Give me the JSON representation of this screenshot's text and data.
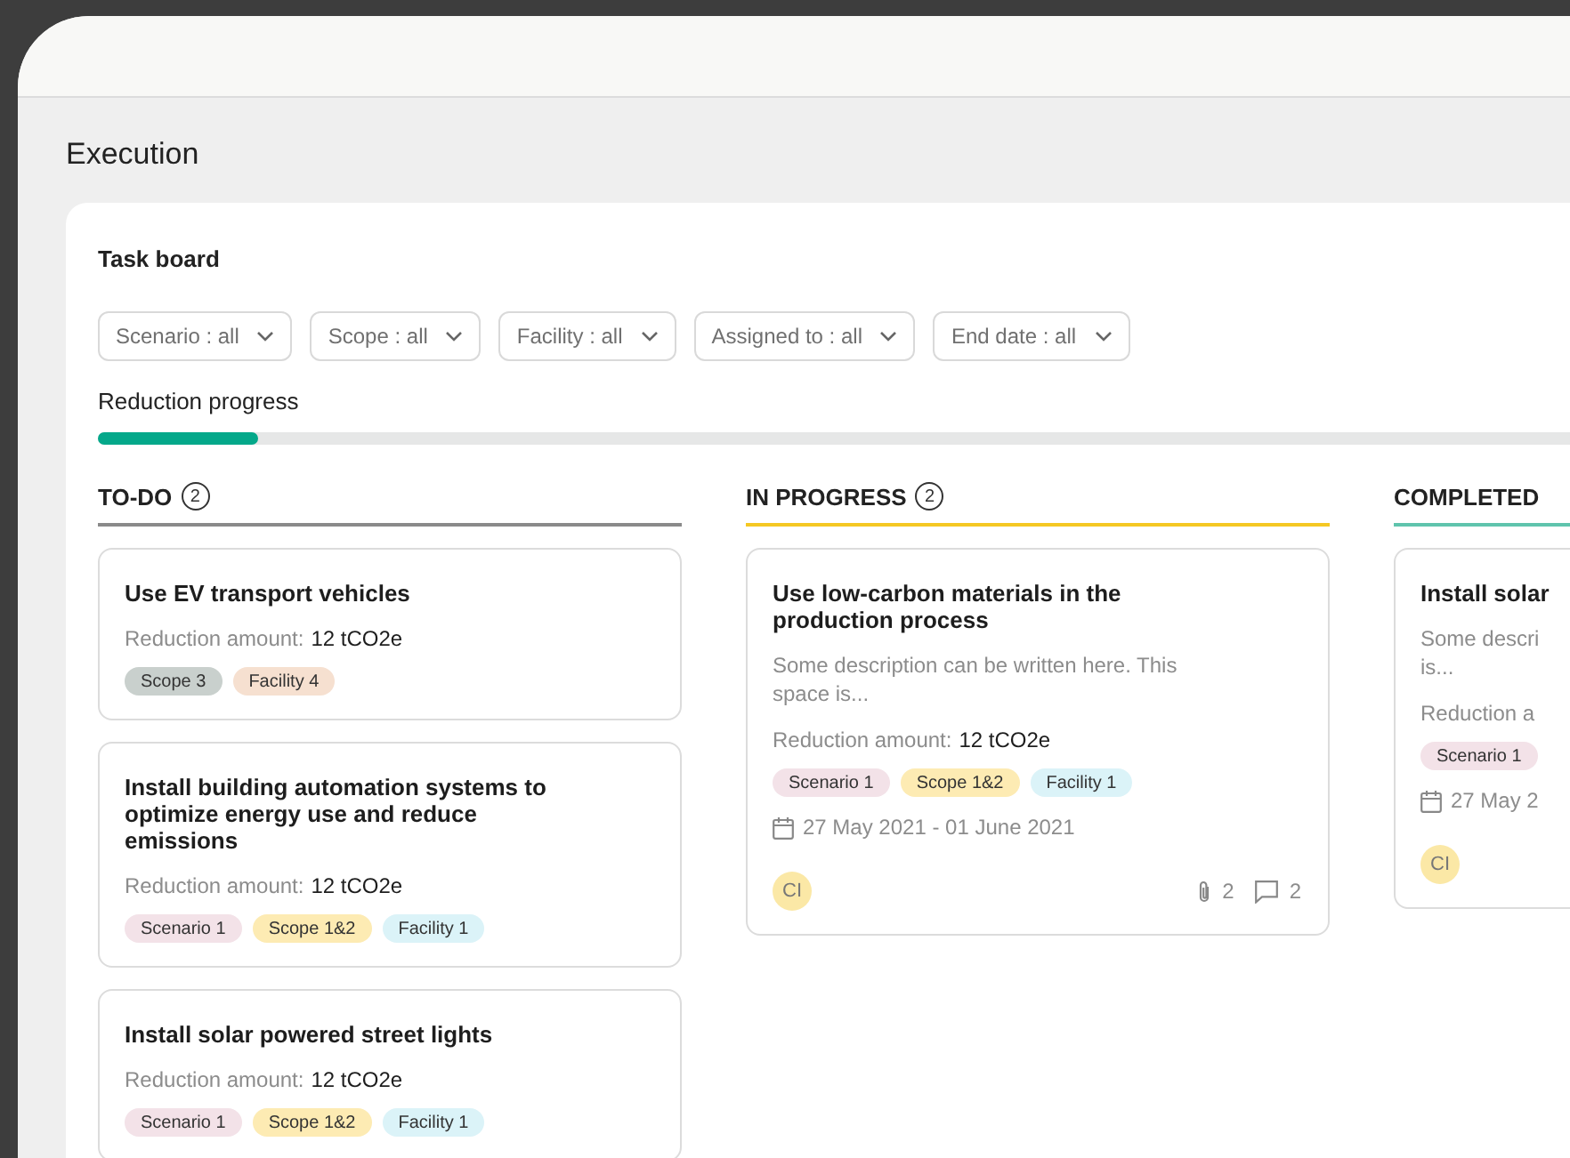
{
  "page": {
    "title": "Execution"
  },
  "board": {
    "title": "Task board",
    "filters": [
      {
        "label": "Scenario : all"
      },
      {
        "label": "Scope : all"
      },
      {
        "label": "Facility : all"
      },
      {
        "label": "Assigned to : all"
      },
      {
        "label": "End date : all"
      }
    ],
    "progress": {
      "label": "Reduction progress",
      "level": 0.1
    },
    "columns": [
      {
        "title": "TO-DO",
        "count": "2",
        "color": "#8a8a8a",
        "cards": [
          {
            "title": "Use EV transport vehicles",
            "amount_label": "Reduction amount:",
            "amount": "12 tCO2e",
            "tags": [
              {
                "label": "Scope 3",
                "color": "#c9d0cd"
              },
              {
                "label": "Facility 4",
                "color": "#f6e0d0"
              }
            ]
          },
          {
            "title": "Install building automation systems to optimize energy use and reduce emissions",
            "amount_label": "Reduction amount:",
            "amount": "12 tCO2e",
            "tags": [
              {
                "label": "Scenario 1",
                "color": "#f3e2e8"
              },
              {
                "label": "Scope 1&2",
                "color": "#fdebb3"
              },
              {
                "label": "Facility 1",
                "color": "#dbf3f8"
              }
            ]
          },
          {
            "title": "Install solar powered street lights",
            "amount_label": "Reduction amount:",
            "amount": "12 tCO2e",
            "tags": [
              {
                "label": "Scenario 1",
                "color": "#f3e2e8"
              },
              {
                "label": "Scope 1&2",
                "color": "#fdebb3"
              },
              {
                "label": "Facility 1",
                "color": "#dbf3f8"
              }
            ]
          }
        ]
      },
      {
        "title": "IN PROGRESS",
        "count": "2",
        "color": "#f5c823",
        "cards": [
          {
            "title": "Use low-carbon materials in the production process",
            "description": "Some description can be written here. This space is...",
            "amount_label": "Reduction amount:",
            "amount": "12 tCO2e",
            "tags": [
              {
                "label": "Scenario 1",
                "color": "#f3e2e8"
              },
              {
                "label": "Scope 1&2",
                "color": "#fdebb3"
              },
              {
                "label": "Facility 1",
                "color": "#dbf3f8"
              }
            ],
            "date": "27 May 2021 - 01 June 2021",
            "avatar": "CI",
            "attachments": "2",
            "comments": "2"
          }
        ]
      },
      {
        "title": "COMPLETED",
        "color": "#5fc4ad",
        "cards": [
          {
            "title": "Install solar",
            "description": "Some descri\nis...",
            "amount_label": "Reduction a",
            "tags": [
              {
                "label": "Scenario 1",
                "color": "#f3e2e8"
              }
            ],
            "date": "27 May 2",
            "avatar": "CI"
          }
        ]
      }
    ]
  }
}
